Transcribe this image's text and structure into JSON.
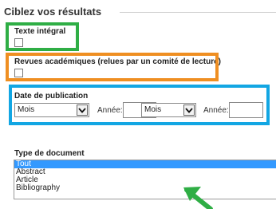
{
  "refine": {
    "title": "Ciblez vos résultats"
  },
  "filters": {
    "full_text": {
      "label": "Texte intégral",
      "checked": false
    },
    "scholarly": {
      "label": "Revues académiques (relues par un comité de lecture)",
      "checked": false
    },
    "pub_date": {
      "label": "Date de publication",
      "from_month": "Mois",
      "from_year_label": "Année:",
      "from_year_value": "",
      "separator": "–",
      "to_month": "Mois",
      "to_year_label": "Année:",
      "to_year_value": ""
    },
    "doc_type": {
      "label": "Type de document",
      "options": [
        "Tout",
        "Abstract",
        "Article",
        "Bibliography"
      ],
      "selected": "Tout"
    }
  },
  "annotations": {
    "full_text_box_color": "#2fae45",
    "scholarly_box_color": "#ef8f22",
    "pub_date_box_color": "#12a6e3",
    "arrow_color": "#2fae45",
    "arrow_icon": "arrow-up-left-icon"
  }
}
